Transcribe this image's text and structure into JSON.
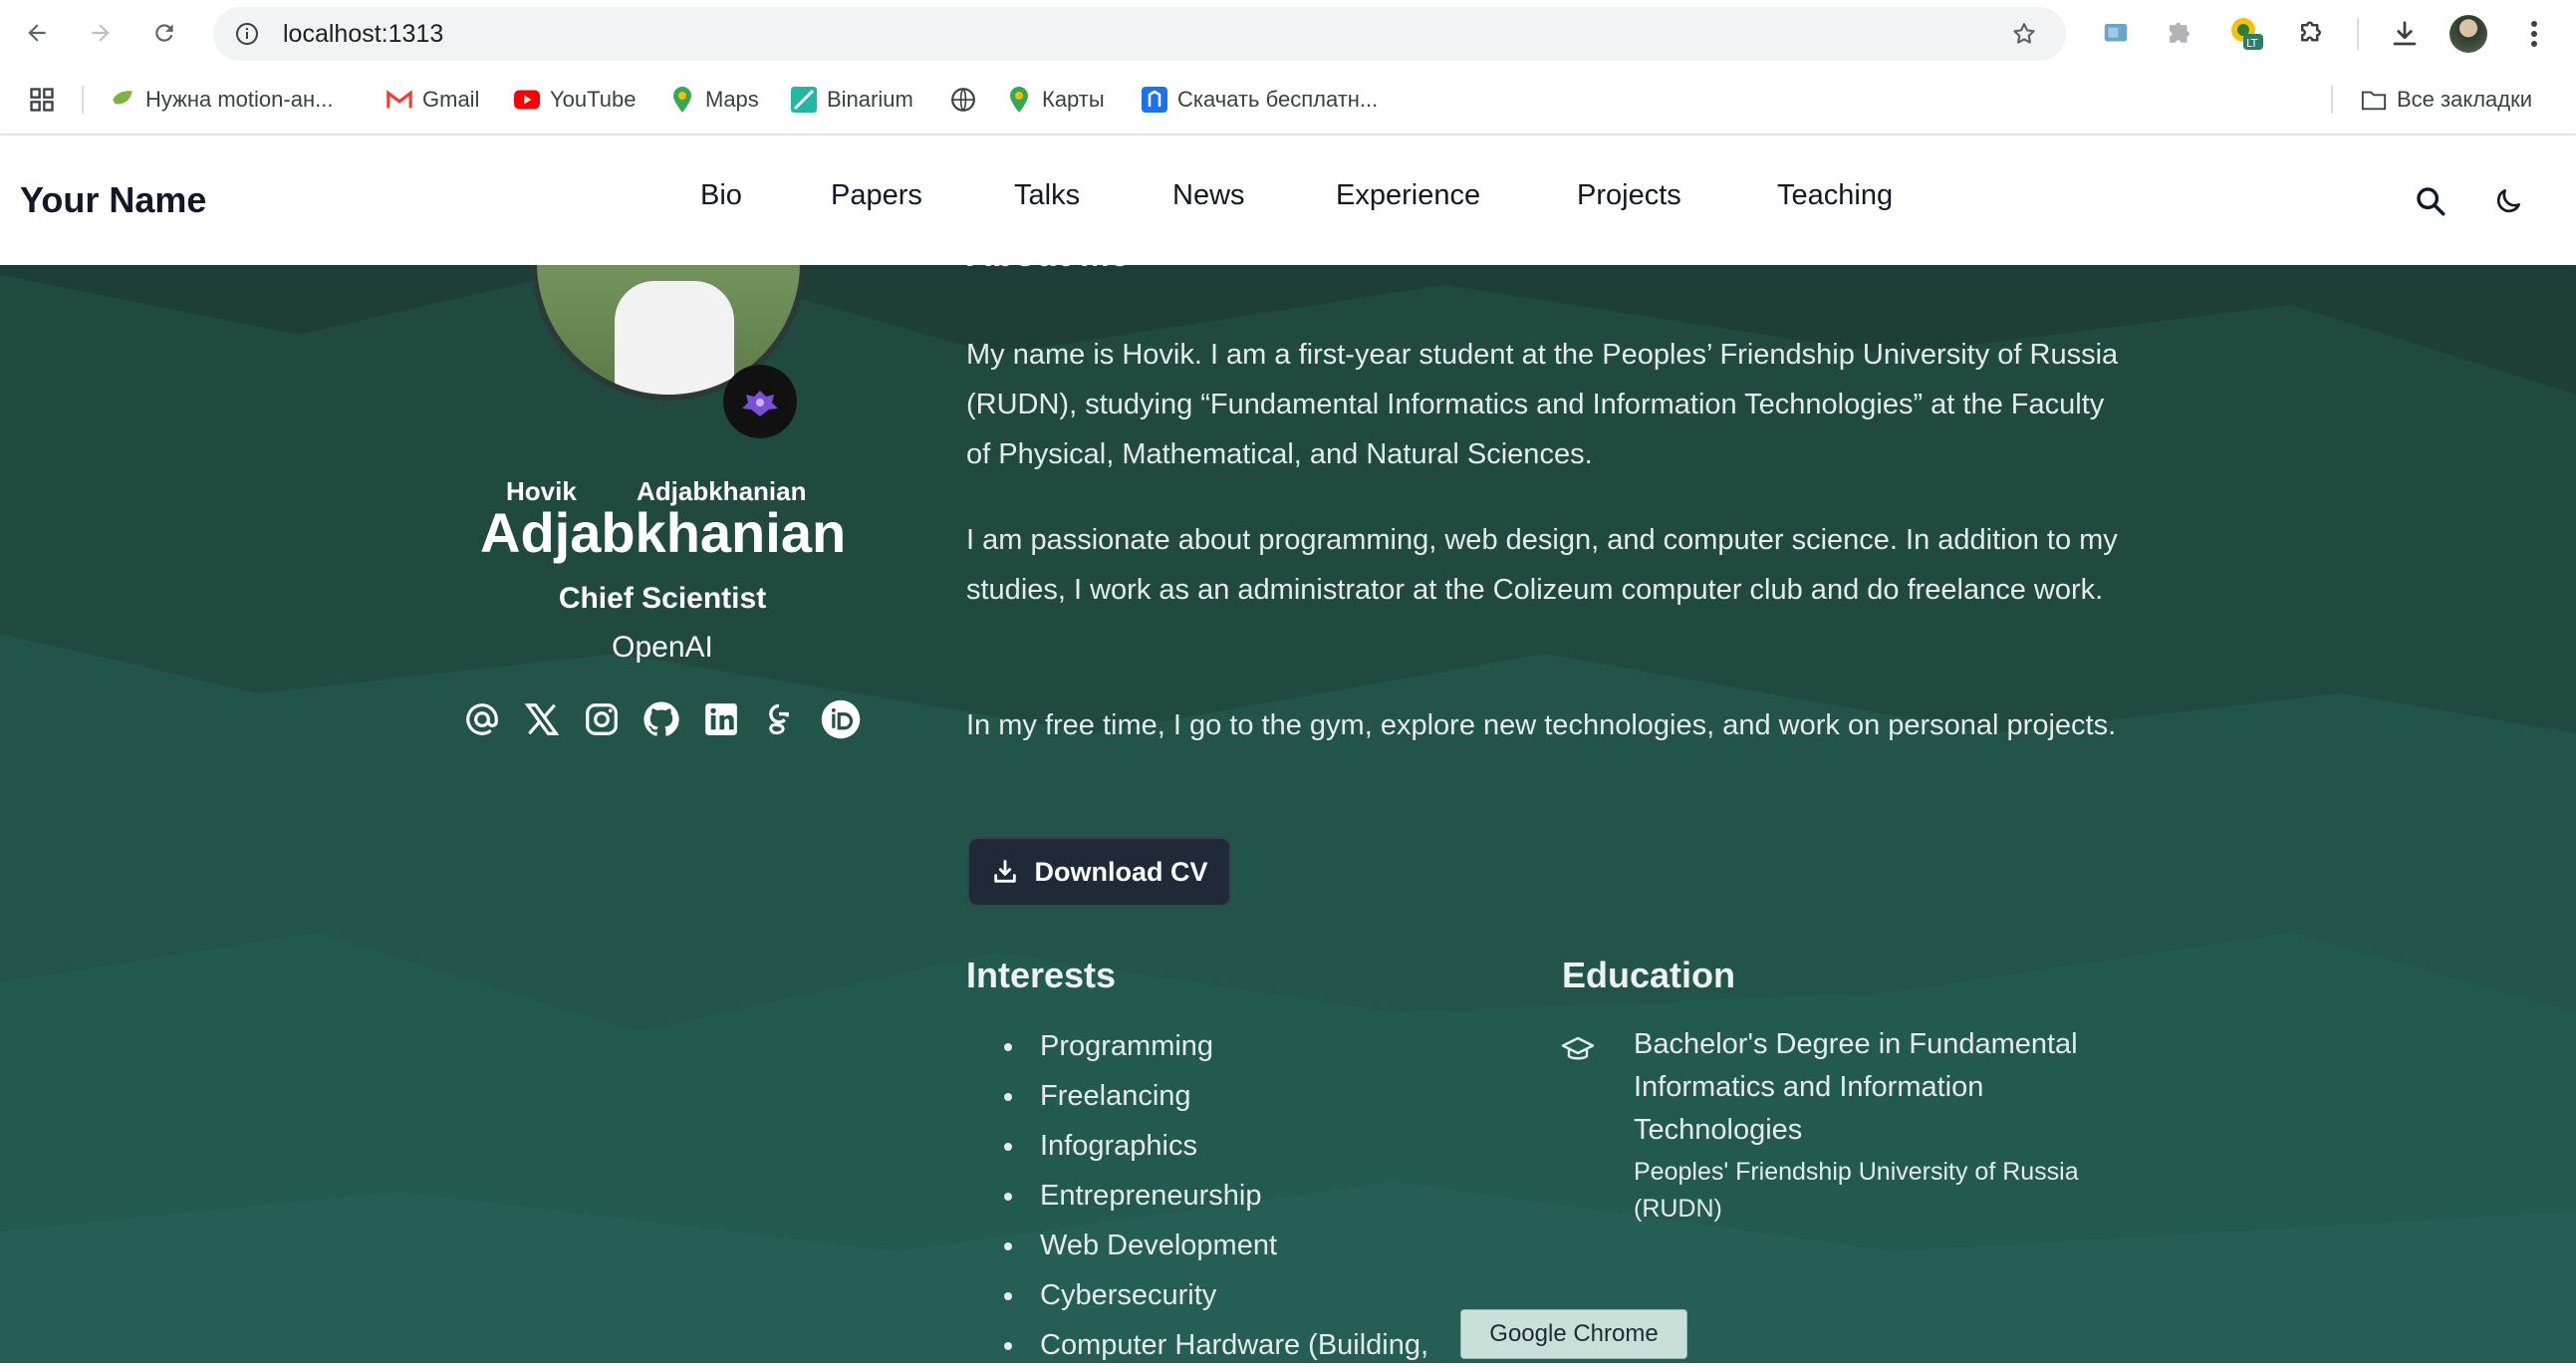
{
  "browser": {
    "url": "localhost:1313",
    "bookmarks": [
      {
        "label": "Нужна motion-ан..."
      },
      {
        "label": "Gmail"
      },
      {
        "label": "YouTube"
      },
      {
        "label": "Maps"
      },
      {
        "label": "Binarium"
      },
      {
        "label": ""
      },
      {
        "label": "Карты"
      },
      {
        "label": "Скачать бесплатн..."
      }
    ],
    "all_bookmarks": "Все закладки",
    "tooltip": "Google Chrome"
  },
  "header": {
    "brand": "Your Name",
    "nav": [
      "Bio",
      "Papers",
      "Talks",
      "News",
      "Experience",
      "Projects",
      "Teaching"
    ]
  },
  "profile": {
    "first_name": "Hovik",
    "middle_name": "Adjabkhanian",
    "last_name": "Adjabkhanian",
    "role": "Chief Scientist",
    "org": "OpenAI",
    "socials": [
      "email-icon",
      "x-icon",
      "instagram-icon",
      "github-icon",
      "linkedin-icon",
      "google-scholar-icon",
      "orcid-icon"
    ]
  },
  "about": {
    "heading": "About Me",
    "paragraphs": [
      "My name is Hovik. I am a first-year student at the Peoples’ Friendship University of Russia (RUDN), studying “Fundamental Informatics and Information Technologies” at the Faculty of Physical, Mathematical, and Natural Sciences.",
      "I am passionate about programming, web design, and computer science. In addition to my studies, I work as an administrator at the Colizeum computer club and do freelance work.",
      "In my free time, I go to the gym, explore new technologies, and work on personal projects."
    ],
    "cv_button": "Download CV"
  },
  "interests": {
    "heading": "Interests",
    "items": [
      "Programming",
      "Freelancing",
      "Infographics",
      "Entrepreneurship",
      "Web Development",
      "Cybersecurity",
      "Computer Hardware (Building,"
    ]
  },
  "education": {
    "heading": "Education",
    "degree": "Bachelor's Degree in Fundamental Informatics and Information Technologies",
    "institution": "Peoples' Friendship University of Russia (RUDN)"
  },
  "colors": {
    "page_bg": "#1e4d44",
    "header_bg": "#ffffff",
    "button_bg": "#1f2937",
    "text_light": "#e5ece9"
  }
}
